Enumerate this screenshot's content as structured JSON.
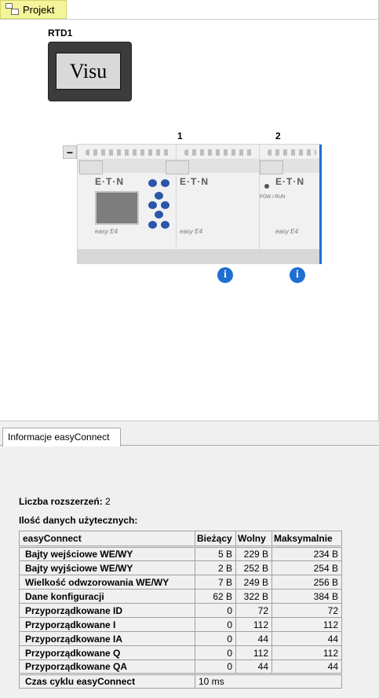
{
  "project_tab": {
    "label": "Projekt"
  },
  "rtd": {
    "label": "RTD1",
    "screen_text": "Visu"
  },
  "hardware": {
    "module_numbers": [
      "1",
      "2"
    ],
    "collapse_label": "−",
    "brand": "E·T·N",
    "series": "easy E4",
    "led_label": "POW / RUN",
    "info_glyph": "i"
  },
  "info_panel": {
    "tab_label": "Informacje easyConnect",
    "extensions_label": "Liczba rozszerzeń:",
    "extensions_value": "2",
    "data_heading": "Ilość danych użytecznych:",
    "table": {
      "headers": [
        "easyConnect",
        "Bieżący",
        "Wolny",
        "Maksymalnie"
      ],
      "rows": [
        {
          "label": "Bajty wejściowe WE/WY",
          "current": "5 B",
          "free": "229 B",
          "max": "234 B"
        },
        {
          "label": "Bajty wyjściowe WE/WY",
          "current": "2 B",
          "free": "252 B",
          "max": "254 B"
        },
        {
          "label": "Wielkość odwzorowania WE/WY",
          "current": "7 B",
          "free": "249 B",
          "max": "256 B"
        },
        {
          "label": "Dane konfiguracji",
          "current": "62 B",
          "free": "322 B",
          "max": "384 B"
        },
        {
          "label": "Przyporządkowane ID",
          "current": "0",
          "free": "72",
          "max": "72"
        },
        {
          "label": "Przyporządkowane I",
          "current": "0",
          "free": "112",
          "max": "112"
        },
        {
          "label": "Przyporządkowane IA",
          "current": "0",
          "free": "44",
          "max": "44"
        },
        {
          "label": "Przyporządkowane Q",
          "current": "0",
          "free": "112",
          "max": "112"
        },
        {
          "label": "Przyporządkowane QA",
          "current": "0",
          "free": "44",
          "max": "44"
        }
      ],
      "cycle": {
        "label": "Czas cyklu easyConnect",
        "value": "10 ms"
      }
    }
  },
  "colors": {
    "tab_highlight": "#f4f49a",
    "selection": "#1f6fd1",
    "keys": "#2b56a8"
  }
}
